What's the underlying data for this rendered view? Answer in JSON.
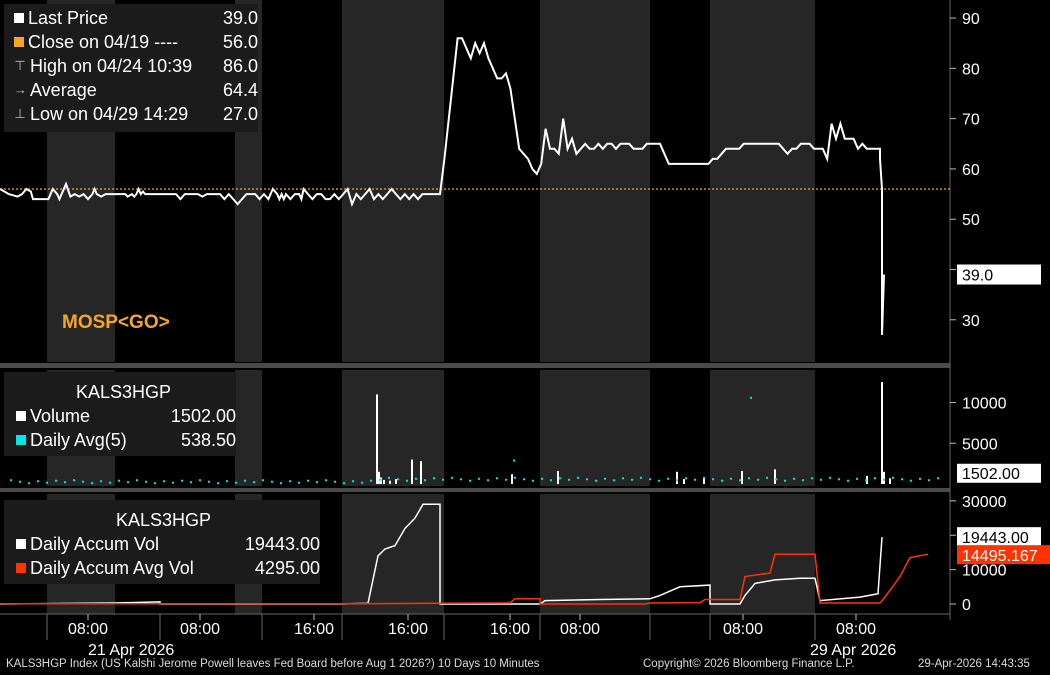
{
  "colors": {
    "background": "#000000",
    "band": "#262626",
    "price": "#ffffff",
    "close_line": "#f5a623",
    "volume": "#ffffff",
    "avg": "#00e5e5",
    "accum": "#ffffff",
    "accum_avg": "#ff3300"
  },
  "ticker_label": "MOSP<GO>",
  "price_legend": {
    "rows": [
      {
        "label": "Last Price",
        "value": "39.0",
        "marker": "square-white"
      },
      {
        "label": "Close on 04/19 ----",
        "value": "56.0",
        "marker": "square-orange"
      },
      {
        "label": "High on 04/24 10:39",
        "value": "86.0",
        "marker": "high-icon"
      },
      {
        "label": "Average",
        "value": "64.4",
        "marker": "average-icon"
      },
      {
        "label": "Low on 04/29 14:29",
        "value": "27.0",
        "marker": "low-icon"
      }
    ]
  },
  "volume_legend": {
    "title": "KALS3HGP",
    "rows": [
      {
        "label": "Volume",
        "value": "1502.00"
      },
      {
        "label": "Daily Avg(5)",
        "value": "538.50"
      }
    ]
  },
  "accum_legend": {
    "title": "KALS3HGP",
    "rows": [
      {
        "label": "Daily Accum Vol",
        "value": "19443.00"
      },
      {
        "label": "Daily Accum Avg Vol",
        "value": "4295.00"
      }
    ]
  },
  "footer": {
    "left": "KALS3HGP Index (US Kalshi Jerome Powell leaves Fed Board before Aug 1 2026?) 10 Days 10 Minutes",
    "center": "Copyright© 2026 Bloomberg Finance L.P.",
    "right": "29-Apr-2026 14:43:35"
  },
  "chart_data": [
    {
      "type": "line",
      "panel": "price",
      "ylim": [
        22,
        92
      ],
      "yticks": [
        30,
        40,
        50,
        60,
        70,
        80,
        90
      ],
      "ytick_labels": [
        "30",
        "",
        "50",
        "60",
        "70",
        "80",
        "90"
      ],
      "last_value_label": "39.0",
      "reference_line": {
        "name": "Close on 04/19",
        "value": 56
      },
      "series": [
        {
          "name": "Last Price",
          "x": [
            0,
            2,
            4,
            5,
            6,
            7,
            7.5,
            8,
            8.5,
            9,
            10,
            11,
            12,
            13,
            13.5,
            14,
            15,
            16,
            17,
            18,
            19,
            20,
            21,
            21.5,
            22,
            23,
            24,
            25,
            26,
            27,
            28,
            28.5,
            29,
            30,
            30.5,
            31,
            31.5,
            32,
            32.5,
            33,
            33.5,
            34,
            35,
            36,
            37,
            38,
            39,
            40,
            41,
            42,
            43,
            44,
            45,
            46,
            47,
            48,
            49,
            50,
            51,
            52,
            53,
            54,
            55,
            56,
            57,
            58,
            59,
            60,
            61,
            62,
            63,
            63.5,
            64,
            64.5,
            65,
            66,
            67,
            68,
            68.5,
            69,
            70,
            71,
            72,
            73,
            74,
            75,
            76,
            77,
            78,
            79,
            80,
            81,
            82,
            83,
            84,
            85,
            86,
            87,
            88,
            89,
            90,
            91,
            92,
            93,
            94,
            95,
            96,
            97,
            98,
            99,
            100
          ],
          "y": [
            56,
            55,
            54.5,
            55,
            56,
            55.5,
            54,
            54,
            54,
            54,
            54,
            54,
            56,
            55,
            54,
            55,
            57,
            54.5,
            55,
            54.5,
            55,
            54,
            55,
            56,
            55,
            54.5,
            55,
            55,
            55,
            55,
            55,
            55,
            54.5,
            55,
            54.5,
            55,
            56,
            55,
            55.5,
            55,
            55,
            55,
            55,
            55,
            55,
            55,
            55,
            55,
            54,
            55,
            55,
            55,
            55,
            54.5,
            55,
            55,
            55,
            55,
            54,
            55,
            54,
            53,
            54,
            55,
            55,
            55,
            54,
            55,
            54,
            56,
            55,
            54,
            55,
            54,
            55,
            54,
            55,
            55,
            54,
            56,
            55,
            54,
            55,
            55,
            54,
            54,
            55,
            54,
            55,
            56,
            53,
            55,
            54,
            55,
            56,
            54,
            55,
            54,
            55,
            56,
            55,
            54,
            55,
            54,
            55,
            54,
            55,
            55,
            55,
            55,
            55
          ],
          "x2": [
            100,
            101,
            102,
            103,
            104,
            105,
            106,
            107,
            108,
            109,
            110,
            111,
            112,
            113,
            114,
            115,
            116,
            117,
            118,
            119,
            120,
            121,
            122,
            123,
            124,
            125,
            126,
            127,
            128,
            129,
            130,
            131,
            132,
            133,
            134,
            135,
            136,
            137,
            138,
            139,
            140,
            141,
            142,
            143,
            144,
            145,
            146,
            147,
            148,
            149,
            150,
            151,
            152,
            153,
            154,
            155,
            156,
            157,
            158,
            159,
            160,
            161,
            162,
            163,
            164,
            165,
            166,
            167,
            168,
            169,
            170,
            171,
            172,
            173,
            174,
            175,
            176,
            177,
            178,
            179,
            180,
            181,
            182,
            183,
            184,
            185,
            186,
            187,
            188,
            189,
            190,
            191,
            192,
            193,
            194,
            195,
            196,
            197,
            198,
            199,
            200
          ],
          "y2": [
            55,
            62,
            70,
            78,
            86,
            86,
            84,
            82,
            85,
            83,
            85,
            82,
            80,
            78,
            78,
            79,
            76,
            70,
            64,
            63,
            62,
            60,
            59,
            61,
            68,
            64,
            64,
            63,
            70,
            64,
            66,
            63,
            64,
            65,
            64,
            64,
            65,
            64,
            65,
            65,
            64,
            65,
            65,
            65,
            64,
            64,
            64,
            65,
            65,
            65,
            65,
            63,
            61,
            61,
            61,
            61,
            61,
            61,
            61,
            61,
            61,
            61,
            62,
            62,
            63,
            64,
            64,
            64,
            64,
            65,
            65,
            65,
            65,
            65,
            65,
            65,
            65,
            65,
            64,
            63,
            64,
            64,
            65,
            65,
            65,
            64,
            64,
            64,
            62,
            69,
            66,
            69,
            66,
            66,
            66,
            64,
            65,
            64,
            64,
            64,
            64
          ]
        }
      ]
    },
    {
      "type": "bar",
      "panel": "volume",
      "ylim": [
        0,
        13500
      ],
      "yticks": [
        5000,
        10000
      ],
      "ytick_labels": [
        "5000",
        "10000"
      ],
      "last_value_label": "1502.00",
      "series": [
        {
          "name": "Volume",
          "values": "see script"
        },
        {
          "name": "Daily Avg(5)",
          "values": "see script"
        }
      ]
    },
    {
      "type": "line",
      "panel": "accum",
      "ylim": [
        -2000,
        32000
      ],
      "yticks": [
        0,
        10000,
        20000,
        30000
      ],
      "ytick_labels": [
        "0",
        "10000",
        "",
        "30000"
      ],
      "last_value_labels": [
        "19443.00",
        "14495.167"
      ],
      "series": [
        {
          "name": "Daily Accum Vol"
        },
        {
          "name": "Daily Accum Avg Vol"
        }
      ]
    }
  ],
  "x_axis": {
    "tick_labels_top": [
      "08:00",
      "08:00",
      "16:00",
      "16:00",
      "16:00",
      "08:00",
      "08:00",
      "08:00"
    ],
    "tick_labels_bottom": [
      "21 Apr 2026",
      "29 Apr 2026"
    ]
  }
}
